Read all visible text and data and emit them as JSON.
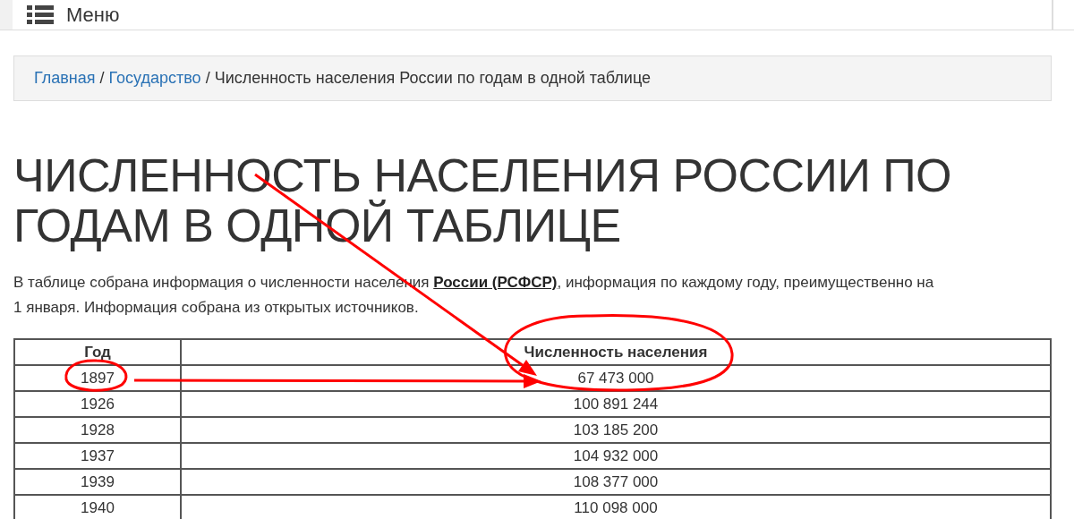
{
  "header": {
    "menu_label": "Меню"
  },
  "breadcrumb": [
    {
      "kind": "link",
      "text": "Главная"
    },
    {
      "kind": "separator",
      "text": "/"
    },
    {
      "kind": "link",
      "text": "Государство"
    },
    {
      "kind": "separator",
      "text": "/"
    },
    {
      "kind": "current",
      "text": "Численность населения России по годам в одной таблице"
    }
  ],
  "title": "ЧИСЛЕННОСТЬ НАСЕЛЕНИЯ РОССИИ ПО ГОДАМ В ОДНОЙ ТАБЛИЦЕ",
  "intro": {
    "before": "В таблице собрана информация о численности населения ",
    "link": "России (РСФСР)",
    "after": ", информация по каждому году, преимущественно на 1 января. Информация собрана из открытых источников."
  },
  "table": {
    "columns": [
      "Год",
      "Численность населения"
    ],
    "rows": [
      [
        "1897",
        "67 473 000"
      ],
      [
        "1926",
        "100 891 244"
      ],
      [
        "1928",
        "103 185 200"
      ],
      [
        "1937",
        "104 932 000"
      ],
      [
        "1939",
        "108 377 000"
      ],
      [
        "1940",
        "110 098 000"
      ]
    ]
  }
}
